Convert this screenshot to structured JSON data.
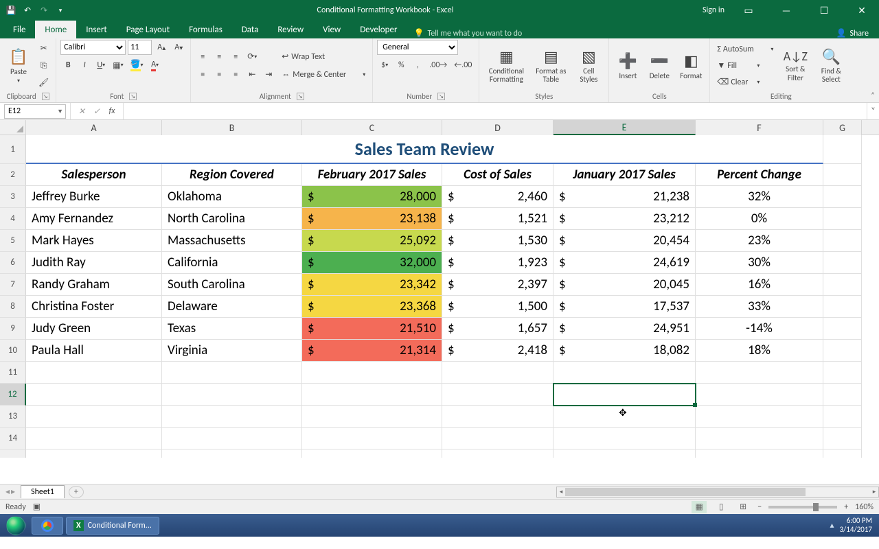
{
  "app": {
    "title": "Conditional Formatting Workbook  -  Excel",
    "signin": "Sign in"
  },
  "tabs": {
    "file": "File",
    "home": "Home",
    "insert": "Insert",
    "pagelayout": "Page Layout",
    "formulas": "Formulas",
    "data": "Data",
    "review": "Review",
    "view": "View",
    "developer": "Developer",
    "tellme": "Tell me what you want to do",
    "share": "Share"
  },
  "ribbon": {
    "clipboard": {
      "label": "Clipboard",
      "paste": "Paste"
    },
    "font": {
      "label": "Font",
      "name": "Calibri",
      "size": "11"
    },
    "alignment": {
      "label": "Alignment",
      "wrap": "Wrap Text",
      "merge": "Merge & Center"
    },
    "number": {
      "label": "Number",
      "format": "General"
    },
    "styles": {
      "label": "Styles",
      "cf": "Conditional Formatting",
      "fat": "Format as Table",
      "cs": "Cell Styles"
    },
    "cells": {
      "label": "Cells",
      "insert": "Insert",
      "delete": "Delete",
      "format": "Format"
    },
    "editing": {
      "label": "Editing",
      "autosum": "AutoSum",
      "fill": "Fill",
      "clear": "Clear",
      "sort": "Sort & Filter",
      "find": "Find & Select"
    }
  },
  "formula": {
    "ref": "E12",
    "value": ""
  },
  "columns": [
    "A",
    "B",
    "C",
    "D",
    "E",
    "F",
    "G"
  ],
  "colwidths": [
    "wA",
    "wB",
    "wC",
    "wD",
    "wE",
    "wF",
    "wG"
  ],
  "title_row": "Sales Team Review",
  "headers": [
    "Salesperson",
    "Region Covered",
    "February 2017 Sales",
    "Cost of Sales",
    "January 2017 Sales",
    "Percent Change"
  ],
  "rows": [
    {
      "n": 3,
      "sp": "Jeffrey Burke",
      "rg": "Oklahoma",
      "feb": "28,000",
      "febcolor": "#8bc34a",
      "cost": "2,460",
      "jan": "21,238",
      "pc": "32%"
    },
    {
      "n": 4,
      "sp": "Amy Fernandez",
      "rg": "North Carolina",
      "feb": "23,138",
      "febcolor": "#f6b44b",
      "cost": "1,521",
      "jan": "23,212",
      "pc": "0%"
    },
    {
      "n": 5,
      "sp": "Mark Hayes",
      "rg": "Massachusetts",
      "feb": "25,092",
      "febcolor": "#c7d94e",
      "cost": "1,530",
      "jan": "20,454",
      "pc": "23%"
    },
    {
      "n": 6,
      "sp": "Judith Ray",
      "rg": "California",
      "feb": "32,000",
      "febcolor": "#4caf50",
      "cost": "1,923",
      "jan": "24,619",
      "pc": "30%"
    },
    {
      "n": 7,
      "sp": "Randy Graham",
      "rg": "South Carolina",
      "feb": "23,342",
      "febcolor": "#f5d742",
      "cost": "2,397",
      "jan": "20,045",
      "pc": "16%"
    },
    {
      "n": 8,
      "sp": "Christina Foster",
      "rg": "Delaware",
      "feb": "23,368",
      "febcolor": "#f5d742",
      "cost": "1,500",
      "jan": "17,537",
      "pc": "33%"
    },
    {
      "n": 9,
      "sp": "Judy Green",
      "rg": "Texas",
      "feb": "21,510",
      "febcolor": "#f36b5a",
      "cost": "1,657",
      "jan": "24,951",
      "pc": "-14%"
    },
    {
      "n": 10,
      "sp": "Paula Hall",
      "rg": "Virginia",
      "feb": "21,314",
      "febcolor": "#f36b5a",
      "cost": "2,418",
      "jan": "18,082",
      "pc": "18%"
    }
  ],
  "empty_rows": [
    11,
    12,
    13,
    14
  ],
  "selected_cell": "E12",
  "sheet": {
    "name": "Sheet1"
  },
  "status": {
    "ready": "Ready",
    "zoom": "160%"
  },
  "taskbar": {
    "app": "Conditional Form...",
    "time": "6:00 PM",
    "date": "3/14/2017"
  },
  "chart_data": {
    "type": "table",
    "title": "Sales Team Review",
    "columns": [
      "Salesperson",
      "Region Covered",
      "February 2017 Sales",
      "Cost of Sales",
      "January 2017 Sales",
      "Percent Change"
    ],
    "data": [
      [
        "Jeffrey Burke",
        "Oklahoma",
        28000,
        2460,
        21238,
        0.32
      ],
      [
        "Amy Fernandez",
        "North Carolina",
        23138,
        1521,
        23212,
        0.0
      ],
      [
        "Mark Hayes",
        "Massachusetts",
        25092,
        1530,
        20454,
        0.23
      ],
      [
        "Judith Ray",
        "California",
        32000,
        1923,
        24619,
        0.3
      ],
      [
        "Randy Graham",
        "South Carolina",
        23342,
        2397,
        20045,
        0.16
      ],
      [
        "Christina Foster",
        "Delaware",
        23368,
        1500,
        17537,
        0.33
      ],
      [
        "Judy Green",
        "Texas",
        21510,
        1657,
        24951,
        -0.14
      ],
      [
        "Paula Hall",
        "Virginia",
        21314,
        2418,
        18082,
        0.18
      ]
    ]
  }
}
